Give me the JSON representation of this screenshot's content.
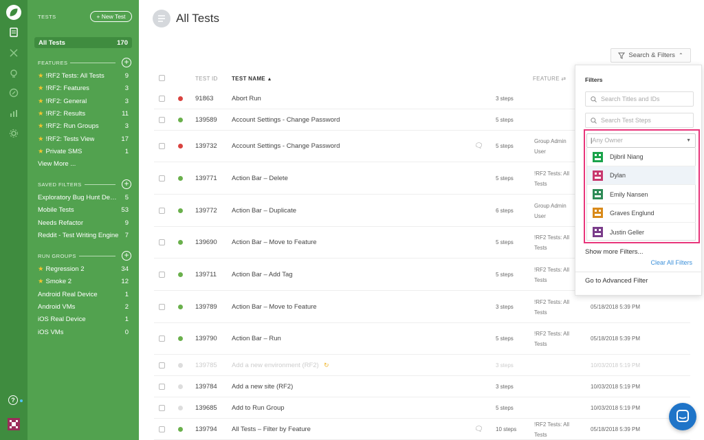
{
  "rail": {
    "icons": [
      "leaf-logo-icon",
      "tests-icon",
      "tools-icon",
      "lightbulb-icon",
      "compass-icon",
      "chart-icon",
      "gear-icon"
    ],
    "help": "?"
  },
  "sidebar": {
    "tests_label": "TESTS",
    "new_test": "+ New Test",
    "all_tests": {
      "label": "All Tests",
      "count": "170"
    },
    "features_label": "FEATURES",
    "features": [
      {
        "label": "!RF2 Tests: All Tests",
        "count": "9"
      },
      {
        "label": "!RF2: Features",
        "count": "3"
      },
      {
        "label": "!RF2: General",
        "count": "3"
      },
      {
        "label": "!RF2: Results",
        "count": "11"
      },
      {
        "label": "!RF2: Run Groups",
        "count": "3"
      },
      {
        "label": "!RF2: Tests View",
        "count": "17"
      },
      {
        "label": "Private SMS",
        "count": "1"
      }
    ],
    "view_more": "View More ...",
    "saved_label": "SAVED FILTERS",
    "saved": [
      {
        "label": "Exploratory Bug Hunt Dem...",
        "count": "5"
      },
      {
        "label": "Mobile Tests",
        "count": "53"
      },
      {
        "label": "Needs Refactor",
        "count": "9"
      },
      {
        "label": "Reddit - Test Writing Engine",
        "count": "7"
      }
    ],
    "run_label": "RUN GROUPS",
    "runs": [
      {
        "label": "Regression 2",
        "count": "34",
        "star": true
      },
      {
        "label": "Smoke 2",
        "count": "12",
        "star": true
      },
      {
        "label": "Android Real Device",
        "count": "1",
        "star": false
      },
      {
        "label": "Android VMs",
        "count": "2",
        "star": false
      },
      {
        "label": "iOS Real Device",
        "count": "1",
        "star": false
      },
      {
        "label": "iOS VMs",
        "count": "0",
        "star": false
      }
    ]
  },
  "main": {
    "title": "All Tests",
    "search_filters": "Search & Filters",
    "columns": {
      "id": "TEST ID",
      "name": "TEST NAME",
      "feature": "FEATURE"
    },
    "rows": [
      {
        "status": "red",
        "id": "91863",
        "name": "Abort Run",
        "comment": false,
        "steps": "3 steps",
        "feature": "",
        "date": "",
        "faded": false
      },
      {
        "status": "green",
        "id": "139589",
        "name": "Account Settings - Change Password",
        "comment": false,
        "steps": "5 steps",
        "feature": "",
        "date": "",
        "faded": false
      },
      {
        "status": "red",
        "id": "139732",
        "name": "Account Settings - Change Password",
        "comment": true,
        "steps": "5 steps",
        "feature": "Group Admin User",
        "date": "",
        "faded": false
      },
      {
        "status": "green",
        "id": "139771",
        "name": "Action Bar – Delete",
        "comment": false,
        "steps": "5 steps",
        "feature": "!RF2 Tests: All Tests",
        "date": "",
        "faded": false
      },
      {
        "status": "green",
        "id": "139772",
        "name": "Action Bar – Duplicate",
        "comment": false,
        "steps": "6 steps",
        "feature": "Group Admin User",
        "date": "",
        "faded": false
      },
      {
        "status": "green",
        "id": "139690",
        "name": "Action Bar – Move to Feature",
        "comment": false,
        "steps": "5 steps",
        "feature": "!RF2 Tests: All Tests",
        "date": "",
        "faded": false
      },
      {
        "status": "green",
        "id": "139711",
        "name": "Action Bar – Add Tag",
        "comment": false,
        "steps": "5 steps",
        "feature": "!RF2 Tests: All Tests",
        "date": "",
        "faded": false
      },
      {
        "status": "green",
        "id": "139789",
        "name": "Action Bar – Move to Feature",
        "comment": false,
        "steps": "3 steps",
        "feature": "!RF2 Tests: All Tests",
        "date": "05/18/2018 5:39 PM",
        "faded": false
      },
      {
        "status": "green",
        "id": "139790",
        "name": "Action Bar – Run",
        "comment": false,
        "steps": "5 steps",
        "feature": "!RF2 Tests: All Tests",
        "date": "05/18/2018 5:39 PM",
        "faded": false
      },
      {
        "status": "grey",
        "id": "139785",
        "name": "Add a new environment (RF2)",
        "comment": false,
        "steps": "3 steps",
        "feature": "",
        "date": "10/03/2018 5:19 PM",
        "faded": true
      },
      {
        "status": "grey",
        "id": "139784",
        "name": "Add a new site (RF2)",
        "comment": false,
        "steps": "3 steps",
        "feature": "",
        "date": "10/03/2018 5:19 PM",
        "faded": false
      },
      {
        "status": "grey",
        "id": "139685",
        "name": "Add to Run Group",
        "comment": false,
        "steps": "5 steps",
        "feature": "",
        "date": "10/03/2018 5:19 PM",
        "faded": false
      },
      {
        "status": "green",
        "id": "139794",
        "name": "All Tests – Filter by Feature",
        "comment": true,
        "steps": "10 steps",
        "feature": "!RF2 Tests: All Tests",
        "date": "05/18/2018 5:39 PM",
        "faded": false
      }
    ]
  },
  "filters": {
    "title": "Filters",
    "search_titles": "Search Titles and IDs",
    "search_steps": "Search Test Steps",
    "owner_placeholder": "Any Owner",
    "owners": [
      "Djibril Niang",
      "Dylan",
      "Emily Nansen",
      "Graves Englund",
      "Justin Geller"
    ],
    "show_more": "Show more Filters...",
    "clear_all": "Clear All Filters",
    "advanced": "Go to Advanced Filter"
  },
  "colors": {
    "sidebar": "#52a24f",
    "rail": "#3f8c3f",
    "highlight": "#e8347a",
    "link": "#3b8fd9",
    "green_dot": "#6ab04c",
    "red_dot": "#d9433f"
  }
}
